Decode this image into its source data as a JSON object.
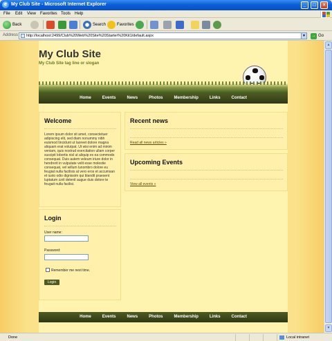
{
  "window": {
    "title": "My Club Site - Microsoft Internet Explorer",
    "minimize": "_",
    "maximize": "□",
    "close": "×",
    "ie_glyph": "e"
  },
  "menu": [
    "File",
    "Edit",
    "View",
    "Favorites",
    "Tools",
    "Help"
  ],
  "toolbar": {
    "back": "Back",
    "search": "Search",
    "favorites": "Favorites"
  },
  "address": {
    "label": "Address",
    "url": "http://localhost:2499/Club%20Web%20Site%20Starter%20Kit1/default.aspx",
    "go": "Go"
  },
  "site": {
    "title": "My Club Site",
    "tagline": "My Club Site tag line or slogan"
  },
  "nav": [
    "Home",
    "Events",
    "News",
    "Photos",
    "Membership",
    "Links",
    "Contact"
  ],
  "welcome": {
    "heading": "Welcome",
    "body": "Lorem ipsum dolor sit amet, consectetuer adipiscing elit, sed diam nonummy nibh euismod tincidunt ut laoreet dolore magna aliquam erat volutpat. Ut wisi enim ad minim veniam, quis nostrud exercitation ullam corper suscipit lobortis nisl ut aliquip ex ea commodo consequat. Duis autem veleum iriure dolor in hendrerit in vulputate velit esse molestie consequat, vel willum lunombro dolore eu feugiat nulla facilisis at vero eros et accumsan et iusto odio dignissim qui blandit praesent luptatum zzril delenit augue duis dolore te feugait nulla facilisi."
  },
  "login": {
    "heading": "Login",
    "username_label": "User name:",
    "password_label": "Password:",
    "remember_label": "Remember me next time.",
    "button": "Login"
  },
  "news": {
    "heading": "Recent news",
    "link": "Read all news articles »"
  },
  "events": {
    "heading": "Upcoming Events",
    "link": "View all events »"
  },
  "status": {
    "left": "Done",
    "zone": "Local intranet"
  }
}
